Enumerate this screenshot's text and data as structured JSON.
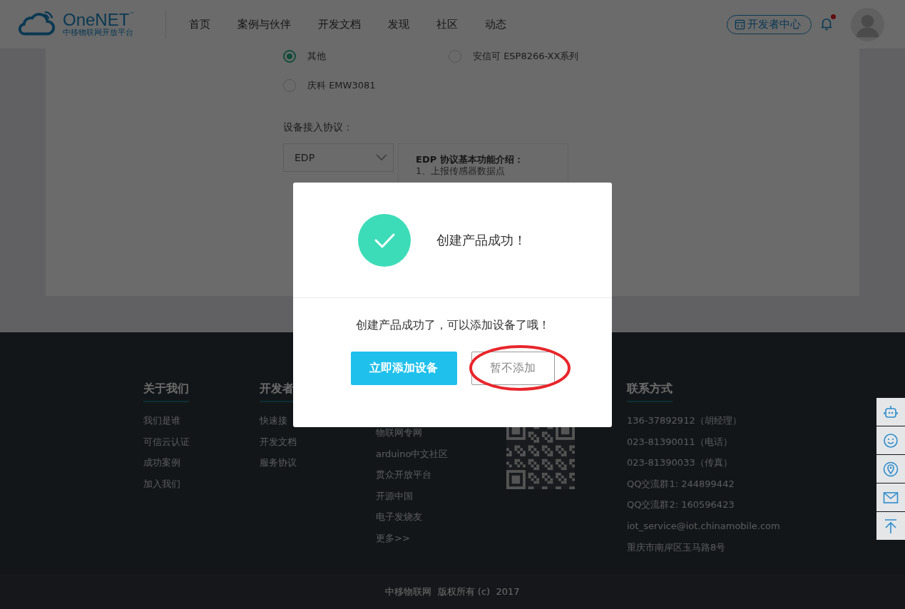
{
  "header": {
    "logo": {
      "name": "OneNET",
      "trademark": "™",
      "subtitle": "中移物联网开放平台"
    },
    "nav": [
      "首页",
      "案例与伙伴",
      "开发文档",
      "发现",
      "社区",
      "动态"
    ],
    "dev_center_button": "开发者中心",
    "notification": {
      "unread": true
    }
  },
  "form": {
    "module_options": [
      {
        "label": "其他",
        "selected": true
      },
      {
        "label": "安信可 ESP8266-XX系列",
        "selected": false
      },
      {
        "label": "庆科 EMW3081",
        "selected": false
      }
    ],
    "protocol_label": "设备接入协议：",
    "protocol_select": "EDP",
    "protocol_info": {
      "title": "EDP 协议基本功能介绍：",
      "lines": [
        "1、上报传感器数据点"
      ]
    }
  },
  "modal": {
    "title": "创建产品成功！",
    "message": "创建产品成功了，可以添加设备了哦！",
    "buttons": [
      {
        "label": "立即添加设备",
        "kind": "primary",
        "circled": false
      },
      {
        "label": "暂不添加",
        "kind": "secondary",
        "circled": true
      }
    ]
  },
  "footer": {
    "columns": [
      {
        "title": "关于我们",
        "links": [
          "我们是谁",
          "可信云认证",
          "成功案例",
          "加入我们"
        ]
      },
      {
        "title": "开发者",
        "links": [
          "快速接",
          "开发文档",
          "服务协议"
        ]
      },
      {
        "links": [
          "物联网专网",
          "arduino中文社区",
          "贯众开放平台",
          "开源中国",
          "电子发烧友",
          "更多>>"
        ]
      }
    ],
    "contact": {
      "title": "联系方式",
      "lines": [
        "136-37892912（胡经理）",
        "023-81390011（电话）",
        "023-81390033（传真）",
        "QQ交流群1: 244899442",
        "QQ交流群2: 160596423",
        "iot_service@iot.chinamobile.com",
        "重庆市南岸区玉马路8号"
      ]
    },
    "copyright": "中移物联网  版权所有 (c)  2017"
  }
}
